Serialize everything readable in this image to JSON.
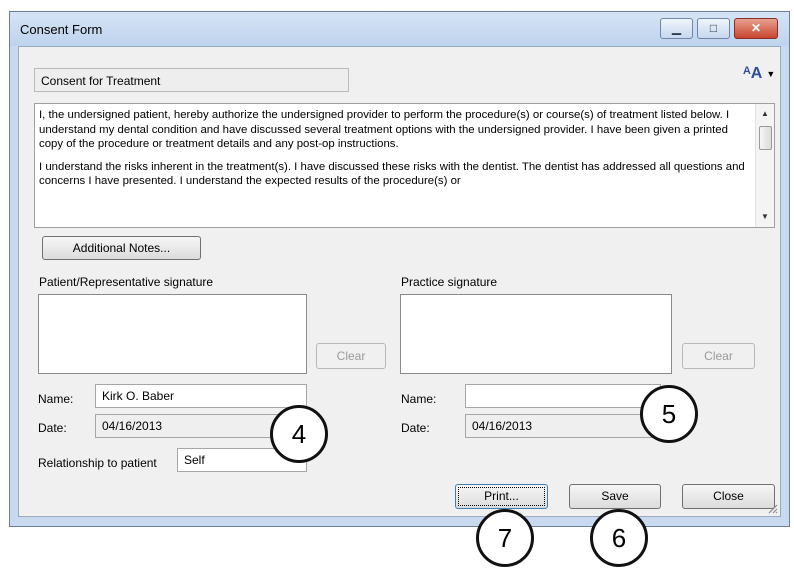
{
  "window": {
    "title": "Consent Form",
    "minimize_glyph": "▁",
    "maximize_glyph": "□",
    "close_glyph": "✕"
  },
  "form": {
    "title": "Consent for Treatment",
    "spell_icon": "spellcheck-icon",
    "text_paragraphs": [
      "I, the undersigned patient, hereby authorize the undersigned provider to perform the procedure(s) or course(s) of treatment listed below. I understand my dental condition and have discussed several treatment options with the undersigned provider. I have been given a printed copy of the procedure or treatment details and any post-op instructions.",
      "I understand the risks inherent in the treatment(s). I have discussed these risks with the dentist. The dentist has addressed all questions and concerns I have presented. I understand the expected results of the procedure(s) or"
    ],
    "additional_notes_label": "Additional Notes..."
  },
  "patient": {
    "signature_label": "Patient/Representative signature",
    "clear_label": "Clear",
    "name_label": "Name:",
    "name_value": "Kirk O. Baber",
    "date_label": "Date:",
    "date_value": "04/16/2013",
    "relationship_label": "Relationship to patient",
    "relationship_value": "Self"
  },
  "practice": {
    "signature_label": "Practice signature",
    "clear_label": "Clear",
    "name_label": "Name:",
    "name_value": "",
    "date_label": "Date:",
    "date_value": "04/16/2013"
  },
  "buttons": {
    "print": "Print...",
    "save": "Save",
    "close": "Close"
  },
  "callouts": [
    "4",
    "5",
    "6",
    "7"
  ],
  "colors": {
    "window_frame": "#c9daf0",
    "close_button": "#c9462f"
  }
}
